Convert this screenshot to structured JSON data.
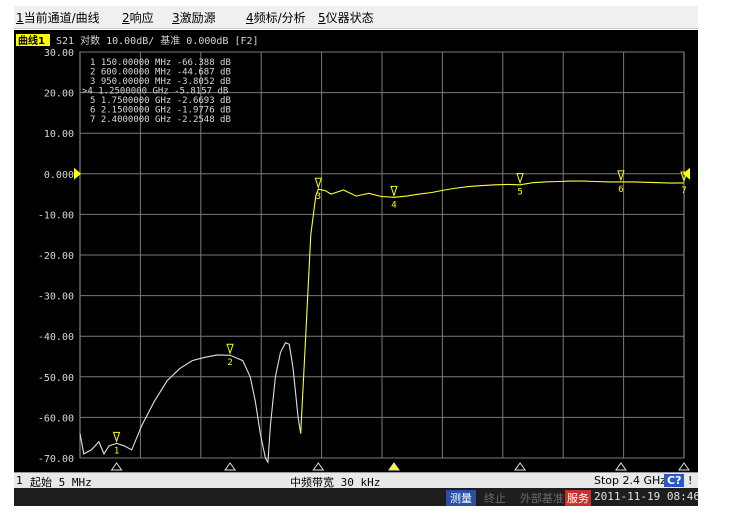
{
  "menu": [
    {
      "key": "1",
      "label": "当前通道/曲线"
    },
    {
      "key": "2",
      "label": "响应"
    },
    {
      "key": "3",
      "label": "激励源"
    },
    {
      "key": "4",
      "label": "频标/分析"
    },
    {
      "key": "5",
      "label": "仪器状态"
    }
  ],
  "trace_header": {
    "trace_label": "曲线1",
    "param": "S21",
    "format": "对数",
    "scale": "10.00dB/",
    "ref_label": "基准",
    "ref_value": "0.000dB",
    "ref_extra": "[F2]"
  },
  "markers_table": [
    {
      "no": "1",
      "active": false,
      "freq": "150.00000",
      "unit": "MHz",
      "value": "-66.388",
      "vunit": "dB"
    },
    {
      "no": "2",
      "active": false,
      "freq": "600.00000",
      "unit": "MHz",
      "value": "-44.687",
      "vunit": "dB"
    },
    {
      "no": "3",
      "active": false,
      "freq": "950.00000",
      "unit": "MHz",
      "value": "-3.8052",
      "vunit": "dB"
    },
    {
      "no": "4",
      "active": true,
      "freq": "1.2500000",
      "unit": "GHz",
      "value": "-5.8157",
      "vunit": "dB"
    },
    {
      "no": "5",
      "active": false,
      "freq": "1.7500000",
      "unit": "GHz",
      "value": "-2.6693",
      "vunit": "dB"
    },
    {
      "no": "6",
      "active": false,
      "freq": "2.1500000",
      "unit": "GHz",
      "value": "-1.9776",
      "vunit": "dB"
    },
    {
      "no": "7",
      "active": false,
      "freq": "2.4000000",
      "unit": "GHz",
      "value": "-2.2548",
      "vunit": "dB"
    }
  ],
  "status_bar": {
    "channel": "1",
    "start_label": "起始 5 MHz",
    "ifbw_label": "中频带宽 30 kHz",
    "stop_label": "Stop 2.4 GHz",
    "badge": "C?",
    "excl": "!"
  },
  "bottom_bar": {
    "meas": "测量",
    "stop": "终止",
    "ext_ref": "外部基准",
    "svc": "服务",
    "datetime": "2011-11-19  08:46"
  },
  "colors": {
    "trace": "#ffff33",
    "trace_white": "#e0e0e0",
    "grid": "#7a7a7a",
    "text": "#d8d8d8",
    "marker": "#ffff00",
    "background": "#000000"
  },
  "chart_data": {
    "type": "line",
    "x_unit": "GHz",
    "x_range": [
      0.005,
      2.4
    ],
    "ylim": [
      -70,
      30
    ],
    "y_ticks": [
      "30.00",
      "20.00",
      "10.00",
      "0.000",
      "-10.00",
      "-20.00",
      "-30.00",
      "-40.00",
      "-50.00",
      "-60.00",
      "-70.00"
    ],
    "grid": true,
    "series": [
      {
        "segment": "stopband",
        "x": [
          0.005,
          0.02,
          0.05,
          0.08,
          0.1,
          0.12,
          0.15,
          0.18,
          0.21,
          0.25,
          0.3,
          0.35,
          0.4,
          0.45,
          0.5,
          0.55,
          0.6,
          0.65,
          0.68,
          0.7,
          0.72,
          0.74,
          0.75,
          0.76,
          0.78,
          0.8,
          0.82,
          0.835,
          0.85,
          0.87,
          0.88
        ],
        "y": [
          -64,
          -69,
          -68,
          -66,
          -69,
          -67,
          -66.4,
          -67,
          -68,
          -62,
          -56,
          -51,
          -48,
          -46,
          -45.2,
          -44.6,
          -44.7,
          -46,
          -50,
          -56,
          -64,
          -70,
          -71,
          -62,
          -50,
          -44,
          -41.6,
          -42,
          -48,
          -60,
          -64
        ]
      },
      {
        "segment": "passband",
        "x": [
          0.88,
          0.9,
          0.92,
          0.94,
          0.95,
          0.98,
          1.0,
          1.05,
          1.1,
          1.15,
          1.2,
          1.25,
          1.3,
          1.35,
          1.4,
          1.45,
          1.5,
          1.55,
          1.6,
          1.65,
          1.7,
          1.75,
          1.8,
          1.85,
          1.9,
          1.95,
          2.0,
          2.05,
          2.1,
          2.15,
          2.2,
          2.25,
          2.3,
          2.35,
          2.4
        ],
        "y": [
          -64,
          -40,
          -15,
          -5.5,
          -3.8,
          -4.2,
          -5.0,
          -4.0,
          -5.5,
          -4.8,
          -5.6,
          -5.8,
          -5.5,
          -5.0,
          -4.6,
          -4.0,
          -3.5,
          -3.1,
          -2.9,
          -2.7,
          -2.6,
          -2.7,
          -2.2,
          -2.0,
          -1.9,
          -1.8,
          -1.8,
          -1.9,
          -2.0,
          -2.0,
          -2.0,
          -2.1,
          -2.2,
          -2.3,
          -2.25
        ]
      }
    ],
    "markers": [
      {
        "no": "1",
        "x": 0.15,
        "y": -66.388
      },
      {
        "no": "2",
        "x": 0.6,
        "y": -44.687
      },
      {
        "no": "3",
        "x": 0.95,
        "y": -3.8052
      },
      {
        "no": "4",
        "x": 1.25,
        "y": -5.8157
      },
      {
        "no": "5",
        "x": 1.75,
        "y": -2.6693
      },
      {
        "no": "6",
        "x": 2.15,
        "y": -1.9776
      },
      {
        "no": "7",
        "x": 2.4,
        "y": -2.2548
      }
    ],
    "ref_level": 0
  }
}
